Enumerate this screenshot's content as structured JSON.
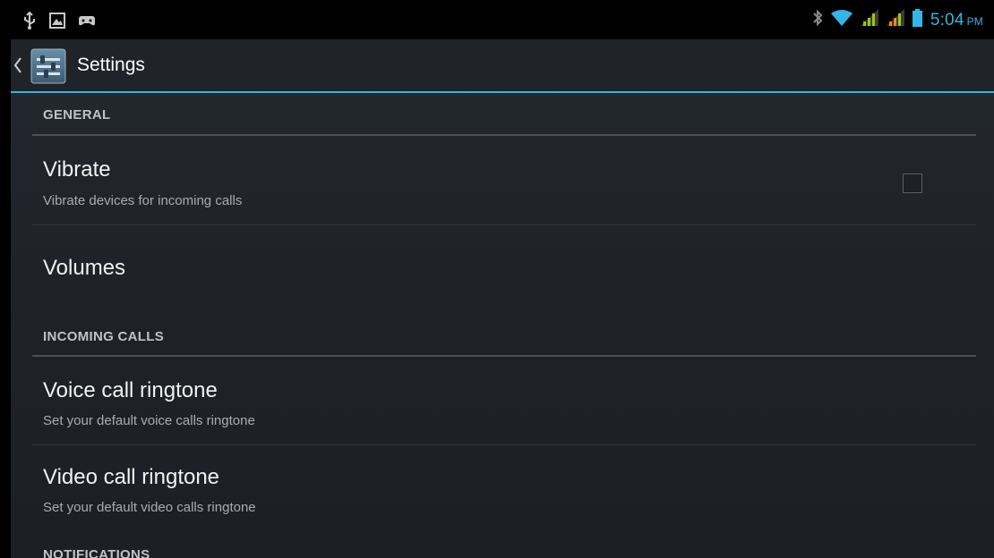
{
  "status_bar": {
    "time": "5:04",
    "ampm": "PM",
    "left_icons": [
      "usb-icon",
      "notification-image-icon",
      "notification-game-icon"
    ],
    "right_icons": [
      "bluetooth-icon",
      "wifi-icon",
      "signal-icon",
      "signal-icon-2",
      "battery-icon"
    ]
  },
  "action_bar": {
    "title": "Settings",
    "icon": "settings-sliders-icon"
  },
  "sections": {
    "general": "GENERAL",
    "incoming_calls": "INCOMING CALLS",
    "notifications": "NOTIFICATIONS"
  },
  "items": {
    "vibrate": {
      "title": "Vibrate",
      "summary": "Vibrate devices for incoming calls",
      "checked": false
    },
    "volumes": {
      "title": "Volumes"
    },
    "voice_ringtone": {
      "title": "Voice call ringtone",
      "summary": "Set your default voice calls ringtone"
    },
    "video_ringtone": {
      "title": "Video call ringtone",
      "summary": "Set your default video calls ringtone"
    }
  },
  "colors": {
    "accent": "#33b5e5",
    "background": "#1f2227",
    "signal_green": "#99cc00",
    "signal_orange": "#ff8800"
  }
}
